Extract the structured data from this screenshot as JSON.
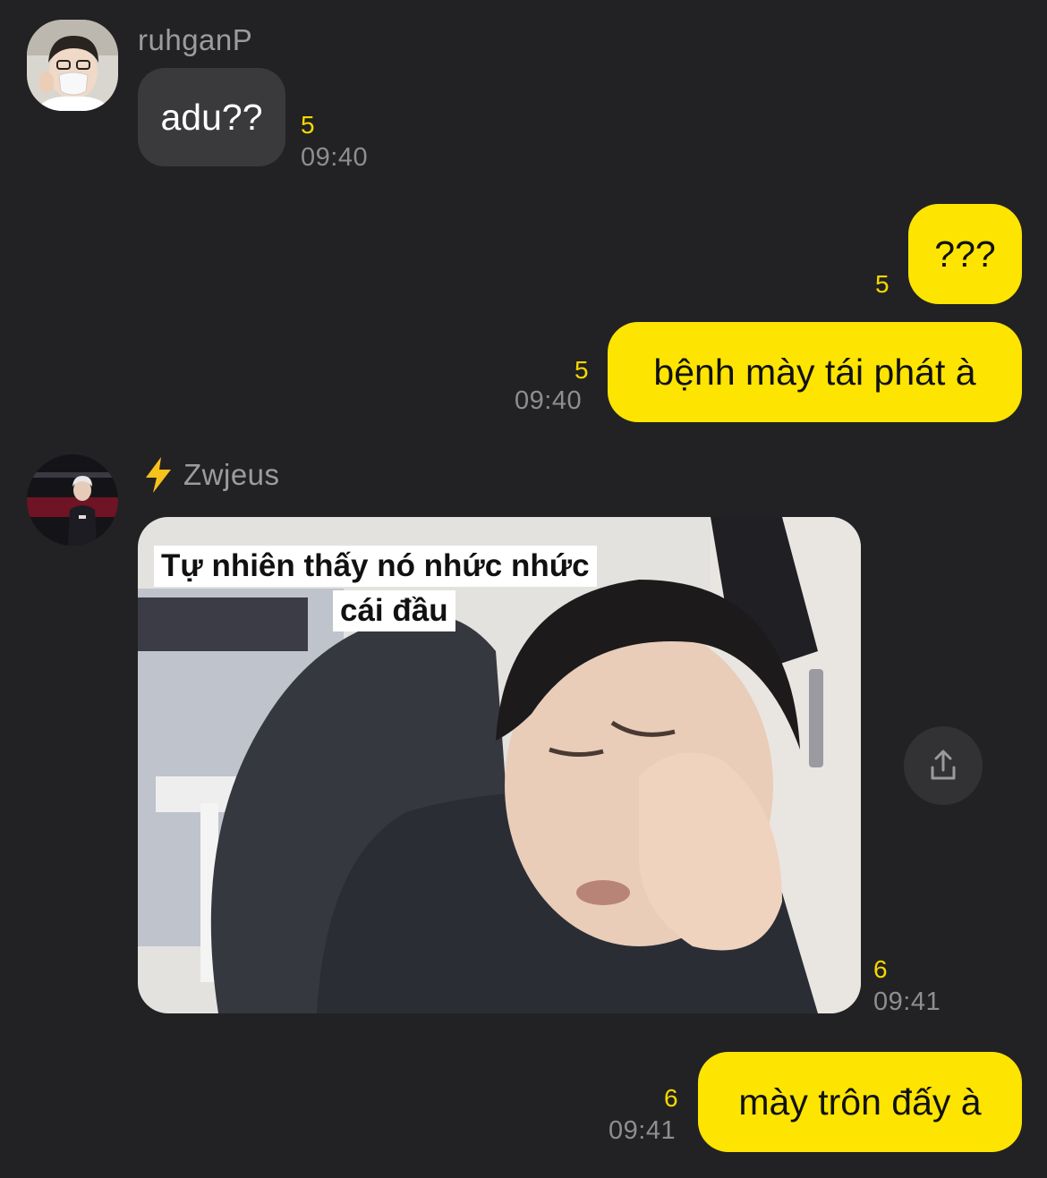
{
  "messages": {
    "m1": {
      "sender": "ruhganP",
      "text": "adu??",
      "unread": "5",
      "time": "09:40"
    },
    "m2": {
      "text": "???",
      "unread": "5"
    },
    "m3": {
      "text": "bệnh mày tái phát à",
      "unread": "5",
      "time": "09:40"
    },
    "m4": {
      "sender_icon": "⚡",
      "sender": "Zwjeus",
      "caption_line1": "Tự nhiên thấy nó nhức nhức",
      "caption_line2": "cái đầu",
      "unread": "6",
      "time": "09:41"
    },
    "m5": {
      "text": "mày trôn đấy à",
      "unread": "6",
      "time": "09:41"
    }
  },
  "icons": {
    "share": "share-icon",
    "lightning": "lightning-icon"
  },
  "colors": {
    "background": "#222224",
    "incoming_bubble": "#3a3a3c",
    "outgoing_bubble": "#fde401",
    "unread": "#f5d800",
    "time": "#8e8e90"
  }
}
